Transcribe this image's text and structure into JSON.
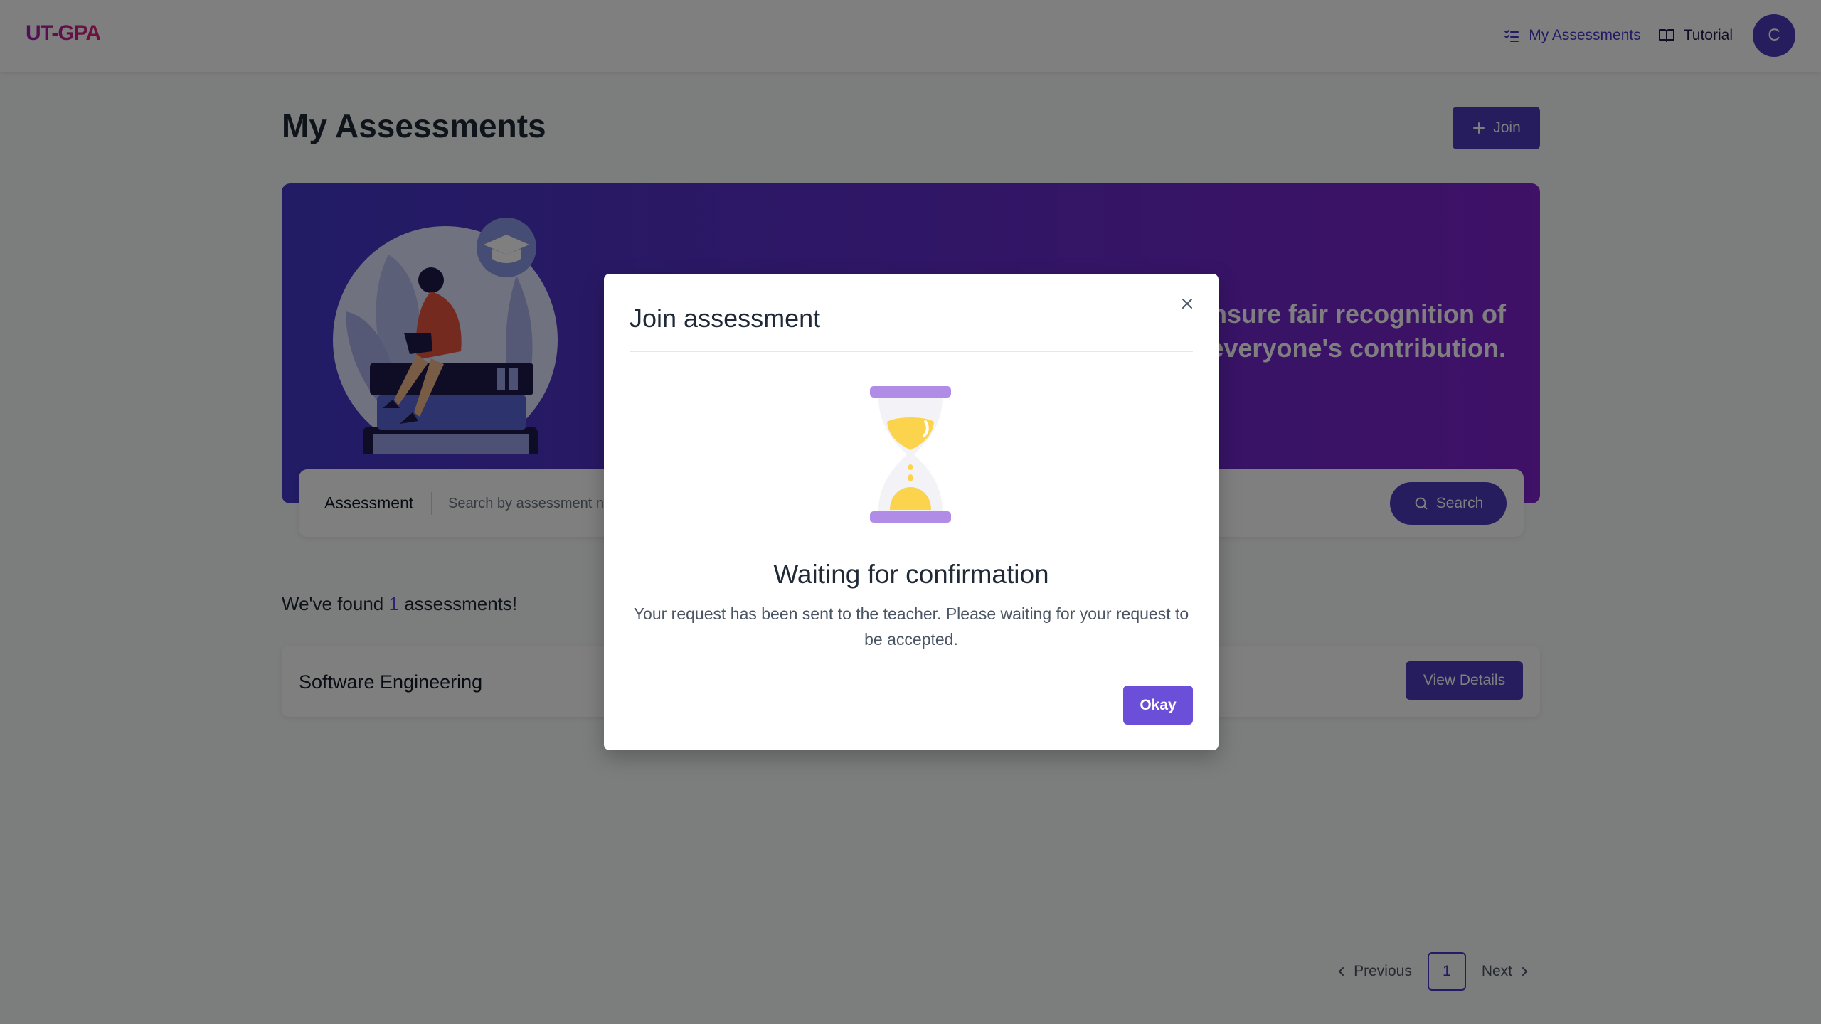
{
  "colors": {
    "brand": "#4f46e5",
    "logo_gradient": [
      "#a21caf",
      "#db2777"
    ],
    "button": "#4c3bbd",
    "banner_gradient": [
      "#4338ca",
      "#7e22ce"
    ],
    "modal_button": "#6b4fd8"
  },
  "header": {
    "logo": "UT-GPA",
    "nav": [
      {
        "label": "My Assessments",
        "icon": "checklist-icon",
        "active": true
      },
      {
        "label": "Tutorial",
        "icon": "book-open-icon",
        "active": false
      }
    ],
    "avatar_initial": "C"
  },
  "main": {
    "title": "My Assessments",
    "join_label": "Join",
    "banner": {
      "line1": "ensure fair recognition of",
      "line2": "everyone's contribution."
    },
    "search": {
      "label": "Assessment",
      "placeholder": "Search by assessment name",
      "button_label": "Search"
    },
    "found": {
      "prefix": "We've found",
      "count": "1",
      "suffix": "assessments!"
    },
    "assessments": [
      {
        "name": "Software Engineering",
        "action": "View Details"
      }
    ],
    "pagination": {
      "previous": "Previous",
      "page": "1",
      "next": "Next"
    }
  },
  "modal": {
    "title": "Join assessment",
    "close_icon": "close-icon",
    "illustration": "hourglass-icon",
    "heading": "Waiting for confirmation",
    "message": "Your request has been sent to the teacher. Please waiting for your request to be accepted.",
    "ok_label": "Okay"
  }
}
